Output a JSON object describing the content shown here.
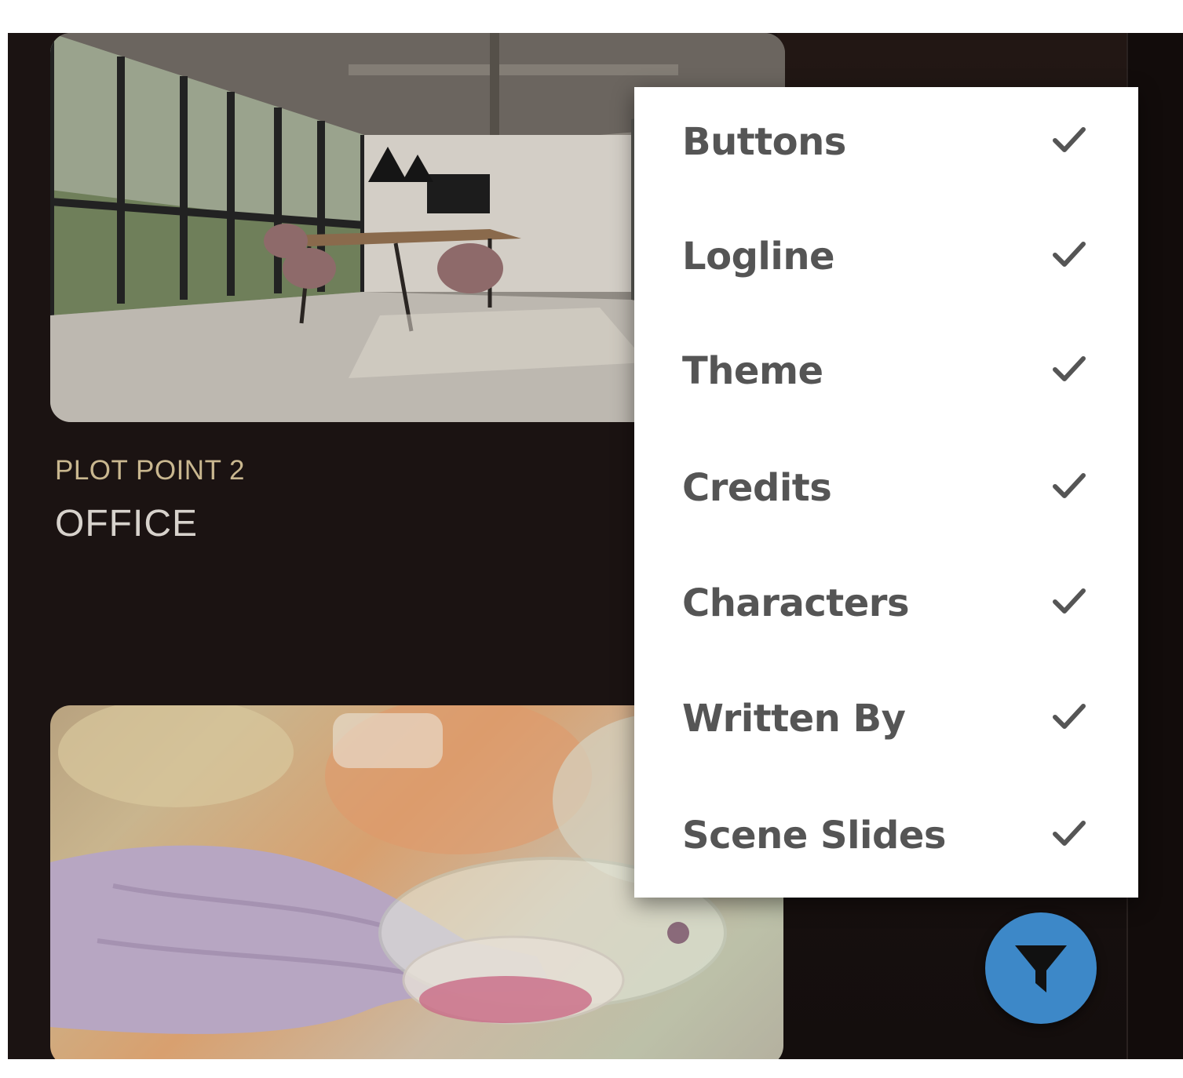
{
  "scene": {
    "plot_label": "PLOT POINT 2",
    "title": "OFFICE"
  },
  "menu": {
    "items": [
      {
        "label": "Buttons",
        "checked": true
      },
      {
        "label": "Logline",
        "checked": true
      },
      {
        "label": "Theme",
        "checked": true
      },
      {
        "label": "Credits",
        "checked": true
      },
      {
        "label": "Characters",
        "checked": true
      },
      {
        "label": "Written By",
        "checked": true
      },
      {
        "label": "Scene Slides",
        "checked": true
      }
    ]
  },
  "icons": {
    "filter_button": "filter-icon",
    "check": "check-icon"
  },
  "colors": {
    "background": "#1b1312",
    "plot_label": "#c9b78f",
    "menu_text": "#555555",
    "filter_button": "#3d88c8"
  }
}
